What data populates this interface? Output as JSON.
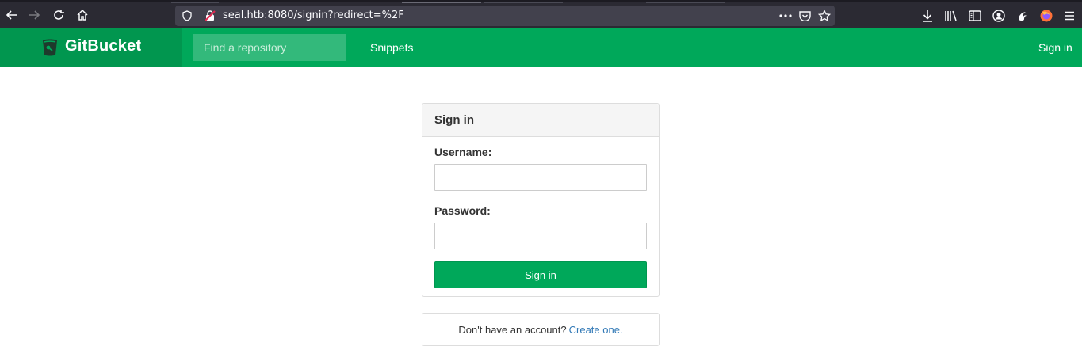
{
  "browser": {
    "url": "seal.htb:8080/signin?redirect=%2F"
  },
  "header": {
    "brand": "GitBucket",
    "search_placeholder": "Find a repository",
    "nav_snippets": "Snippets",
    "nav_signin": "Sign in",
    "colors": {
      "header_bg": "#00a85a",
      "brand_bg": "#01964f"
    }
  },
  "signin_panel": {
    "title": "Sign in",
    "username_label": "Username:",
    "username_value": "",
    "password_label": "Password:",
    "password_value": "",
    "submit_label": "Sign in"
  },
  "signup": {
    "prompt": "Don't have an account?",
    "link": "Create one."
  },
  "icons": [
    "back-arrow-icon",
    "forward-arrow-icon",
    "reload-icon",
    "home-icon",
    "shield-icon",
    "insecure-lock-icon",
    "more-dots-icon",
    "pocket-icon",
    "star-icon",
    "download-icon",
    "library-icon",
    "sidebar-icon",
    "account-icon",
    "extension-icon",
    "firefox-icon",
    "menu-icon",
    "gitbucket-logo-icon"
  ]
}
